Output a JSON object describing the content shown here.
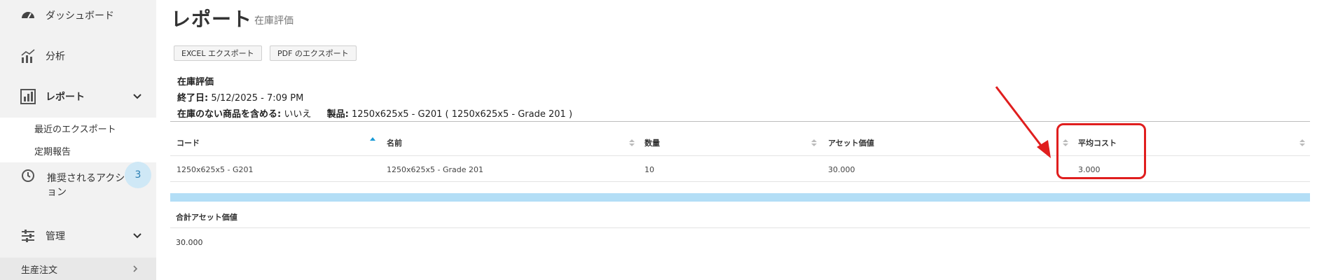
{
  "sidebar": {
    "items": [
      {
        "label": "ダッシュボード",
        "icon": "gauge-icon"
      },
      {
        "label": "分析",
        "icon": "analytics-icon"
      },
      {
        "label": "レポート",
        "icon": "report-icon"
      },
      {
        "label": "推奨されるアクション",
        "icon": "history-icon"
      },
      {
        "label": "管理",
        "icon": "sliders-icon"
      },
      {
        "label": "生産注文",
        "icon": "chevron-right-icon"
      }
    ],
    "report_subitems": [
      "最近のエクスポート",
      "定期報告"
    ],
    "actions_badge": "3"
  },
  "header": {
    "title": "レポート",
    "subtitle": "在庫評価"
  },
  "toolbar": {
    "excel_label": "EXCEL エクスポート",
    "pdf_label": "PDF のエクスポート"
  },
  "report_info": {
    "name": "在庫評価",
    "end_date_label": "終了日:",
    "end_date_value": "5/12/2025 - 7:09 PM",
    "include_label": "在庫のない商品を含める:",
    "include_value": "いいえ",
    "product_label": "製品:",
    "product_value": "1250x625x5 - G201 ( 1250x625x5 - Grade 201 )"
  },
  "table": {
    "columns": [
      "コード",
      "名前",
      "数量",
      "アセット価値",
      "平均コスト"
    ],
    "rows": [
      [
        "1250x625x5 - G201",
        "1250x625x5 - Grade 201",
        "10",
        "30.000",
        "3.000"
      ]
    ]
  },
  "summary": {
    "label": "合計アセット価値",
    "value": "30.000"
  },
  "colors": {
    "accent": "#b3def6",
    "highlight": "#e01e1e",
    "sort_active": "#1a9bd7"
  }
}
